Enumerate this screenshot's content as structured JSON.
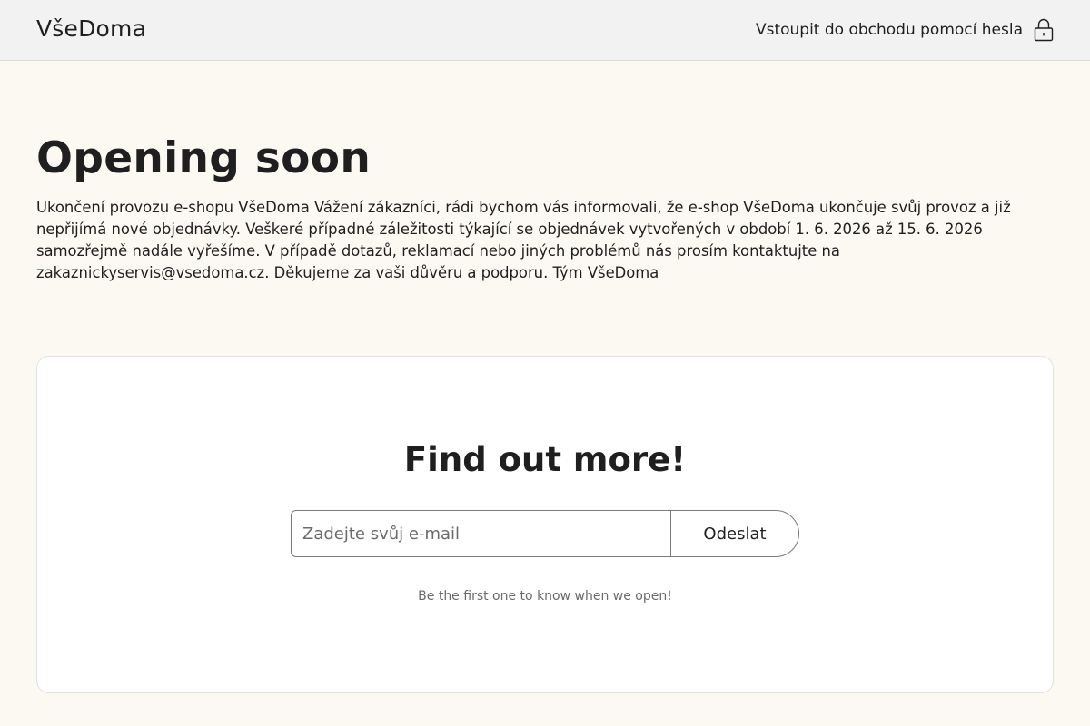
{
  "header": {
    "logo": "VšeDoma",
    "password_link": "Vstoupit do obchodu pomocí hesla",
    "lock_icon": "lock-icon"
  },
  "main": {
    "title": "Opening soon",
    "message": "Ukončení provozu e-shopu VšeDoma Vážení zákazníci, rádi bychom vás informovali, že e-shop VšeDoma ukončuje svůj provoz a již nepřijímá nové objednávky. Veškeré případné záležitosti týkající se objednávek vytvořených v období 1. 6. 2026 až 15. 6. 2026 samozřejmě nadále vyřešíme. V případě dotazů, reklamací nebo jiných problémů nás prosím kontaktujte na zakaznickyservis@vsedoma.cz. Děkujeme za vaši důvěru a podporu. Tým VšeDoma"
  },
  "signup": {
    "title": "Find out more!",
    "email_value": "",
    "email_placeholder": "Zadejte svůj e-mail",
    "submit_label": "Odeslat",
    "note": "Be the first one to know when we open!"
  },
  "colors": {
    "page_background": "#fcf9f3",
    "header_background": "#f2f2f2",
    "card_background": "#ffffff",
    "text": "#1f1f1f"
  }
}
